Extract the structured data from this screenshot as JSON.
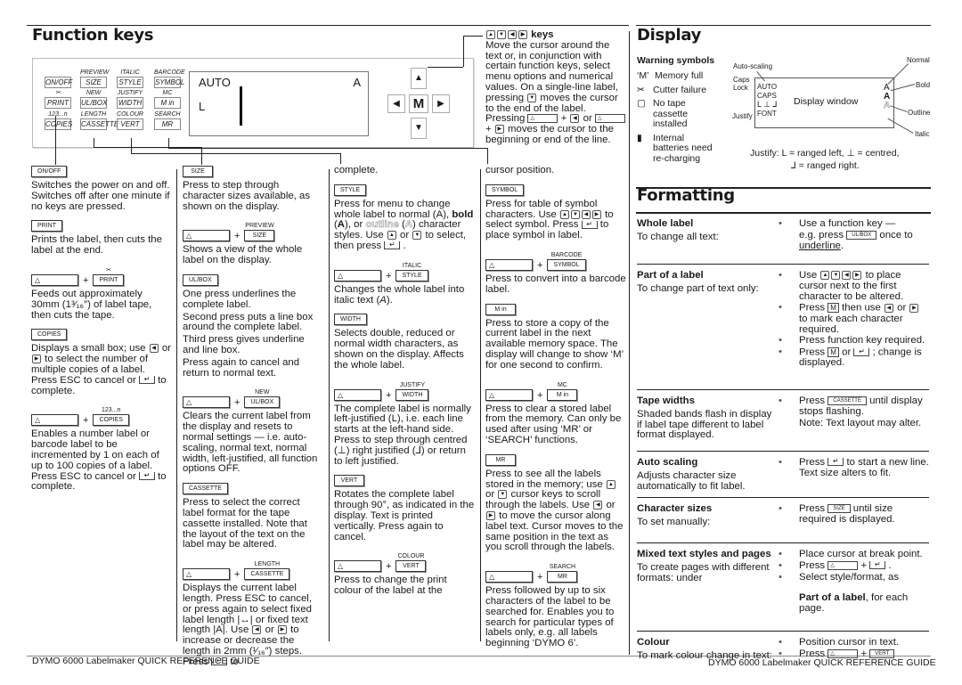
{
  "function_keys": {
    "title": "Function keys",
    "panel": {
      "keys": [
        {
          "sup": "",
          "key": "ON/OFF"
        },
        {
          "sup": "PREVIEW",
          "key": "SIZE"
        },
        {
          "sup": "ITALIC",
          "key": "STYLE"
        },
        {
          "sup": "BARCODE",
          "key": "SYMBOL"
        },
        {
          "sup": "",
          "sup_icon": "scissors",
          "key": "PRINT"
        },
        {
          "sup": "NEW",
          "key": "UL/BOX"
        },
        {
          "sup": "JUSTIFY",
          "key": "WIDTH"
        },
        {
          "sup": "MC",
          "key": "M in"
        },
        {
          "sup": "123...n",
          "key": "COPIES"
        },
        {
          "sup": "LENGTH",
          "key": "CASSETTE"
        },
        {
          "sup": "COLOUR",
          "key": "VERT"
        },
        {
          "sup": "SEARCH",
          "key": "MR"
        }
      ],
      "lcd": {
        "auto": "AUTO",
        "style": "A",
        "justify": "L"
      },
      "m_key": "M"
    },
    "columns": [
      {
        "blocks": [
          {
            "key": "ON/OFF",
            "paras": [
              [
                "Switches the power on and off.  Switches off after one minute if no keys are pressed."
              ]
            ]
          },
          {
            "key": "PRINT",
            "paras": [
              [
                "Prints the label, then cuts the label at the end."
              ]
            ]
          },
          {
            "combo": {
              "sup": "",
              "sup_icon": "scissors",
              "key": "PRINT"
            },
            "paras": [
              [
                "Feeds out approximately 30mm (1³⁄₁₆″) of label tape, then cuts the tape."
              ]
            ]
          },
          {
            "key": "COPIES",
            "paras": [
              [
                "Displays a small box; use ",
                {
                  "a": "left"
                },
                " or ",
                {
                  "a": "right"
                },
                " to select the number of multiple copies of a label. Press ESC to cancel or ",
                {
                  "e": 1
                },
                " to complete."
              ]
            ]
          },
          {
            "combo": {
              "sup": "123...n",
              "key": "COPIES"
            },
            "paras": [
              [
                "Enables a number label or barcode label to be incremented by 1 on each of up to 100 copies of a label. Press ESC to cancel or ",
                {
                  "e": 1
                },
                " to complete."
              ]
            ]
          }
        ]
      },
      {
        "blocks": [
          {
            "key": "SIZE",
            "paras": [
              [
                "Press to step through character sizes available, as shown on the display."
              ]
            ]
          },
          {
            "combo": {
              "sup": "PREVIEW",
              "key": "SIZE"
            },
            "paras": [
              [
                "Shows a view of the whole label on the display."
              ]
            ]
          },
          {
            "key": "UL/BOX",
            "paras": [
              [
                "One press underlines the complete label."
              ],
              [
                "Second press puts a line box around the complete label."
              ],
              [
                "Third press gives underline and line box."
              ],
              [
                "Press again to cancel and return to normal text."
              ]
            ]
          },
          {
            "combo": {
              "sup": "NEW",
              "key": "UL/BOX"
            },
            "paras": [
              [
                "Clears the current label from the display and resets to normal settings — i.e. auto-scaling, normal text, normal width, left-justified, all function options OFF."
              ]
            ]
          },
          {
            "key": "CASSETTE",
            "paras": [
              [
                "Press to select the correct label format for the tape cassette installed. Note that the layout of the text on the label may be altered."
              ]
            ]
          },
          {
            "combo": {
              "sup": "LENGTH",
              "key": "CASSETTE"
            },
            "paras": [
              [
                "Displays the current label length. Press ESC to cancel, or press again to select fixed label length |↔| or fixed text length |A|. Use ",
                {
                  "a": "left"
                },
                " or ",
                {
                  "a": "right"
                },
                " to increase or decrease the length in 2mm (¹⁄₁₆″) steps. Press ",
                {
                  "e": 1
                },
                " to"
              ]
            ]
          }
        ]
      },
      {
        "blocks": [
          {
            "paras": [
              [
                "complete."
              ]
            ]
          },
          {
            "key": "STYLE",
            "paras": [
              [
                "Press for menu to change whole label to normal (A), ",
                {
                  "b": "bold"
                },
                " (",
                {
                  "b": "A"
                },
                "), or ",
                {
                  "o": "outline"
                },
                " (",
                {
                  "o": "A"
                },
                ") character styles. Use ",
                {
                  "a": "up"
                },
                " or ",
                {
                  "a": "down"
                },
                " to select, then press ",
                {
                  "e": 1
                },
                " ."
              ]
            ]
          },
          {
            "combo": {
              "sup": "ITALIC",
              "key": "STYLE"
            },
            "paras": [
              [
                "Changes the whole label into italic text (",
                {
                  "i": "A"
                },
                ")."
              ]
            ]
          },
          {
            "key": "WIDTH",
            "paras": [
              [
                "Selects double, reduced or normal width characters, as shown on the display. Affects the whole label."
              ]
            ]
          },
          {
            "combo": {
              "sup": "JUSTIFY",
              "key": "WIDTH"
            },
            "paras": [
              [
                "The complete label is normally left-justified (L), i.e. each line starts at the left-hand side. Press to step through centred (⊥) right justified (⅃) or return to left justified."
              ]
            ]
          },
          {
            "key": "VERT",
            "paras": [
              [
                "Rotates the complete label through 90°, as indicated in the display. Text is printed vertically. Press again to cancel."
              ]
            ]
          },
          {
            "combo": {
              "sup": "COLOUR",
              "key": "VERT"
            },
            "paras": [
              [
                "Press to change the print colour of the label at the"
              ]
            ]
          }
        ]
      },
      {
        "blocks": [
          {
            "paras": [
              [
                "cursor position."
              ]
            ]
          },
          {
            "key": "SYMBOL",
            "paras": [
              [
                "Press for table of symbol characters. Use ",
                {
                  "a": "up"
                },
                {
                  "a": "down"
                },
                {
                  "a": "left"
                },
                {
                  "a": "right"
                },
                " to select symbol. Press ",
                {
                  "e": 1
                },
                " to place symbol in label."
              ]
            ]
          },
          {
            "combo": {
              "sup": "BARCODE",
              "key": "SYMBOL"
            },
            "paras": [
              [
                "Press to convert into a barcode label."
              ]
            ]
          },
          {
            "key": "M in",
            "paras": [
              [
                "Press to store a copy of the current label in the next available memory space. The display will change to show ‘M’ for one second to confirm."
              ]
            ]
          },
          {
            "combo": {
              "sup": "MC",
              "key": "M in"
            },
            "paras": [
              [
                "Press to clear a stored label from the memory. Can only be used after using ‘MR’ or ‘SEARCH’ functions."
              ]
            ]
          },
          {
            "key": "MR",
            "paras": [
              [
                "Press to see all the labels stored in the memory; use ",
                {
                  "a": "up"
                },
                " or ",
                {
                  "a": "down"
                },
                " cursor keys to scroll through the labels. Use ",
                {
                  "a": "left"
                },
                " or ",
                {
                  "a": "right"
                },
                " to move the cursor along label text. Cursor moves to the same position in the text as you scroll through the labels."
              ]
            ]
          },
          {
            "combo": {
              "sup": "SEARCH",
              "key": "MR"
            },
            "paras": [
              [
                "Press followed by up to six characters of the label to be searched for. Enables you to search for particular types of labels only, e.g. all labels beginning ‘DYMO 6’."
              ]
            ]
          }
        ]
      }
    ],
    "arrow_keys": {
      "heading": "keys",
      "paras": [
        [
          "Move the cursor around the text or, in conjunction with certain function keys, select menu options and numerical values. On a single-line label, pressing ",
          {
            "a": "down"
          },
          " moves the cursor to the end of the label. Pressing ",
          {
            "s": 1
          },
          " + ",
          {
            "a": "left"
          },
          " or ",
          {
            "s": 1
          },
          " + ",
          {
            "a": "right"
          },
          "  moves the cursor to the beginning or end of the line."
        ]
      ]
    }
  },
  "display": {
    "title": "Display",
    "warning_heading": "Warning symbols",
    "warnings": [
      {
        "icon": "M",
        "text": "Memory full"
      },
      {
        "icon": "scissors",
        "text": "Cutter failure"
      },
      {
        "icon": "cassette",
        "text": "No tape cassette installed"
      },
      {
        "icon": "battery",
        "text": "Internal batteries need re-charging"
      }
    ],
    "diagram": {
      "window_label": "Display window",
      "inside": {
        "auto": "AUTO",
        "caps": "CAPS",
        "justify": "L ⊥ ⅃",
        "font": "FONT",
        "normal": "A",
        "bold": "A",
        "outline": "A"
      },
      "callouts": {
        "auto_scaling": "Auto-scaling",
        "caps_lock": "Caps Lock",
        "justify": "Justify",
        "normal": "Normal",
        "bold": "Bold",
        "outline": "Outline",
        "italic": "Italic"
      }
    },
    "justify_note_1": "Justify: L = ranged left,  ⊥ = centred,",
    "justify_note_2": "⅃ = ranged right."
  },
  "formatting": {
    "title": "Formatting",
    "rows": [
      {
        "title": "Whole label",
        "desc": "To change all text:",
        "bullets": [
          [
            "Use a function key —"
          ]
        ],
        "after": [
          [
            "e.g. press ",
            {
              "k": "UL/BOX"
            },
            " once to ",
            {
              "u": "underline"
            },
            "."
          ]
        ]
      },
      {
        "title": "Part of a label",
        "desc": "To change part of text only:",
        "bullets": [
          [
            "Use ",
            {
              "a": "up"
            },
            {
              "a": "down"
            },
            {
              "a": "left"
            },
            {
              "a": "right"
            },
            " to place cursor next to the first character to be altered."
          ],
          [
            "Press ",
            {
              "mk": "M"
            },
            " then use ",
            {
              "a": "left"
            },
            " or ",
            {
              "a": "right"
            },
            " to mark each character required."
          ],
          [
            "Press function key required."
          ],
          [
            "Press ",
            {
              "mk": "M"
            },
            " or ",
            {
              "e": 1
            },
            " ; change is displayed."
          ]
        ]
      },
      {
        "title": "Tape widths",
        "desc": "Shaded bands flash in display if label tape different to label format displayed.",
        "bullets": [
          [
            "Press ",
            {
              "k": "CASSETTE"
            },
            "  until display stops flashing."
          ]
        ],
        "after": [
          [
            "Note: Text layout may alter."
          ]
        ]
      },
      {
        "title": "Auto scaling",
        "desc": "Adjusts character size automatically to fit label.",
        "bullets": [
          [
            "Press ",
            {
              "e": 1
            },
            "  to start a new line. Text size alters to fit."
          ]
        ]
      },
      {
        "title": "Character sizes",
        "desc": "To set manually:",
        "bullets": [
          [
            "Press ",
            {
              "k": "SIZE"
            },
            " until size required is displayed."
          ]
        ]
      },
      {
        "title": "Mixed text styles and pages",
        "desc": "To create pages with different formats: under",
        "bullets": [
          [
            "Place cursor at break point."
          ],
          [
            "Press ",
            {
              "s": 1
            },
            " + ",
            {
              "e": 1
            },
            " ."
          ],
          [
            "Select style/format, as"
          ]
        ],
        "after": [
          [
            {
              "b": "Part of a label"
            },
            ", for each page."
          ]
        ]
      },
      {
        "title": "Colour",
        "desc": "To mark colour change in text:",
        "bullets": [
          [
            "Position cursor in text."
          ],
          [
            "Press ",
            {
              "s": 1
            },
            " + ",
            {
              "k": "VERT"
            }
          ]
        ],
        "colour_sup": "COLOUR"
      }
    ]
  },
  "footer": {
    "left": "DYMO 6000 Labelmaker QUICK REFERENCE GUIDE",
    "right": "DYMO 6000 Labelmaker QUICK REFERENCE GUIDE"
  }
}
